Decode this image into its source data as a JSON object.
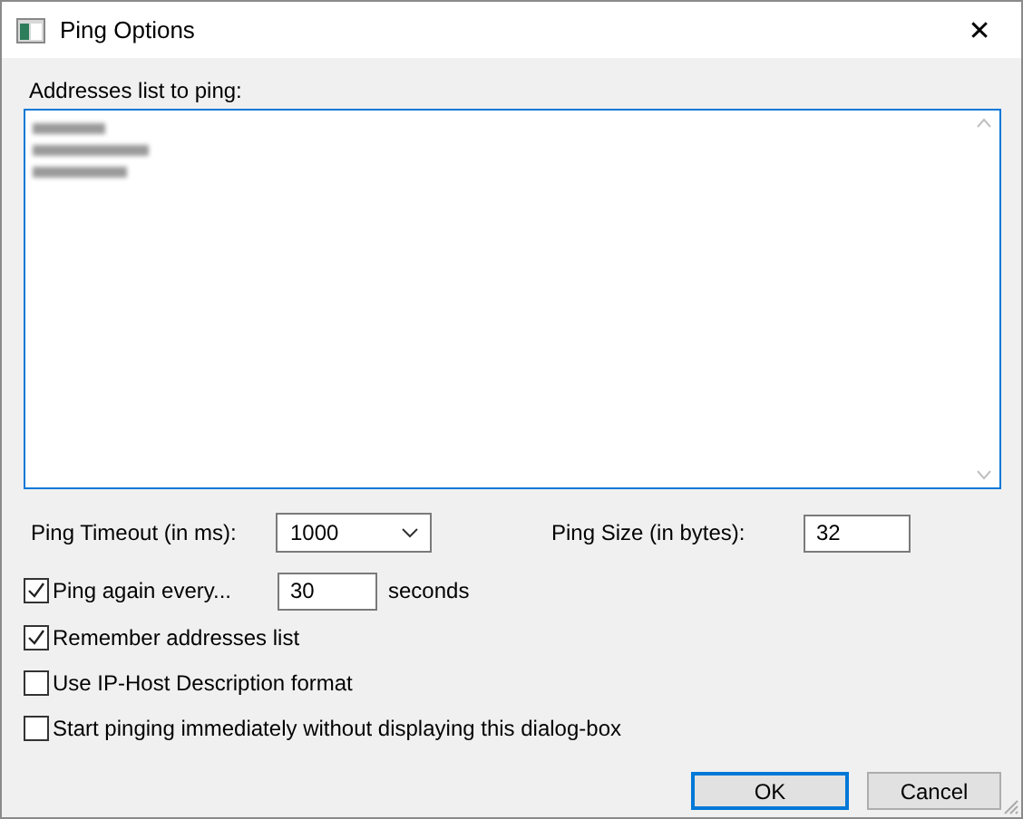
{
  "window": {
    "title": "Ping Options",
    "close": "✕"
  },
  "addresses": {
    "label": "Addresses list to ping:"
  },
  "timeout": {
    "label": "Ping Timeout (in ms):",
    "value": "1000"
  },
  "size": {
    "label": "Ping Size (in bytes):",
    "value": "32"
  },
  "options": [
    {
      "kind": "interval",
      "label": "Ping again every...",
      "checked": true,
      "value": "30",
      "unit": "seconds"
    },
    {
      "kind": "plain",
      "label": "Remember addresses list",
      "checked": true
    },
    {
      "kind": "plain",
      "label": "Use IP-Host Description format",
      "checked": false
    },
    {
      "kind": "plain",
      "label": "Start pinging immediately without displaying this dialog-box",
      "checked": false
    }
  ],
  "buttons": [
    {
      "label": "OK",
      "default": true
    },
    {
      "label": "Cancel",
      "default": false
    }
  ]
}
